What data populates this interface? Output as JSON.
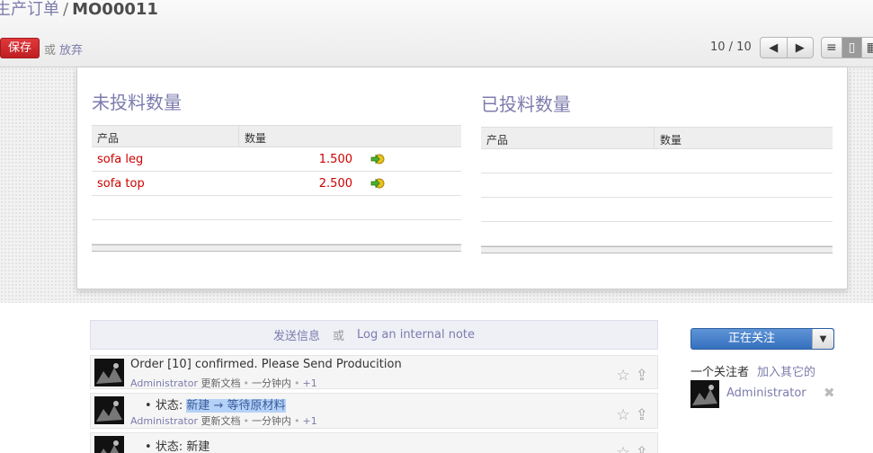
{
  "header": {
    "breadcrumb_parent": "生产订单",
    "breadcrumb_sep": "/",
    "record_name": "MO00011",
    "save_label": "保存",
    "or_label": "或",
    "discard_label": "放弃",
    "pager": "10 / 10"
  },
  "sheet": {
    "left_title": "未投料数量",
    "right_title": "已投料数量",
    "col_product": "产品",
    "col_qty": "数量",
    "to_consume": [
      {
        "product": "sofa leg",
        "qty": "1.500"
      },
      {
        "product": "sofa top",
        "qty": "2.500"
      }
    ]
  },
  "chatter": {
    "send_message": "发送信息",
    "or": "或",
    "log_note": "Log an internal note",
    "messages": [
      {
        "body": "Order [10] confirmed. Please Send Producition",
        "author": "Administrator",
        "action": "更新文档",
        "time": "一分钟内",
        "plus": "+1"
      },
      {
        "bullet": "•",
        "field": "状态:",
        "old": "新建",
        "arrow": "→",
        "new": "等待原材料",
        "author": "Administrator",
        "action": "更新文档",
        "time": "一分钟内",
        "plus": "+1"
      },
      {
        "bullet": "•",
        "field": "状态:",
        "value": "新建"
      }
    ]
  },
  "followers": {
    "following_label": "正在关注",
    "count_label": "一个关注者",
    "add_others": "加入其它的",
    "name": "Administrator"
  },
  "colors": {
    "accent": "#7c7bad",
    "save": "#d1292d",
    "follow": "#3a76c4",
    "red_text": "#cc0000"
  }
}
